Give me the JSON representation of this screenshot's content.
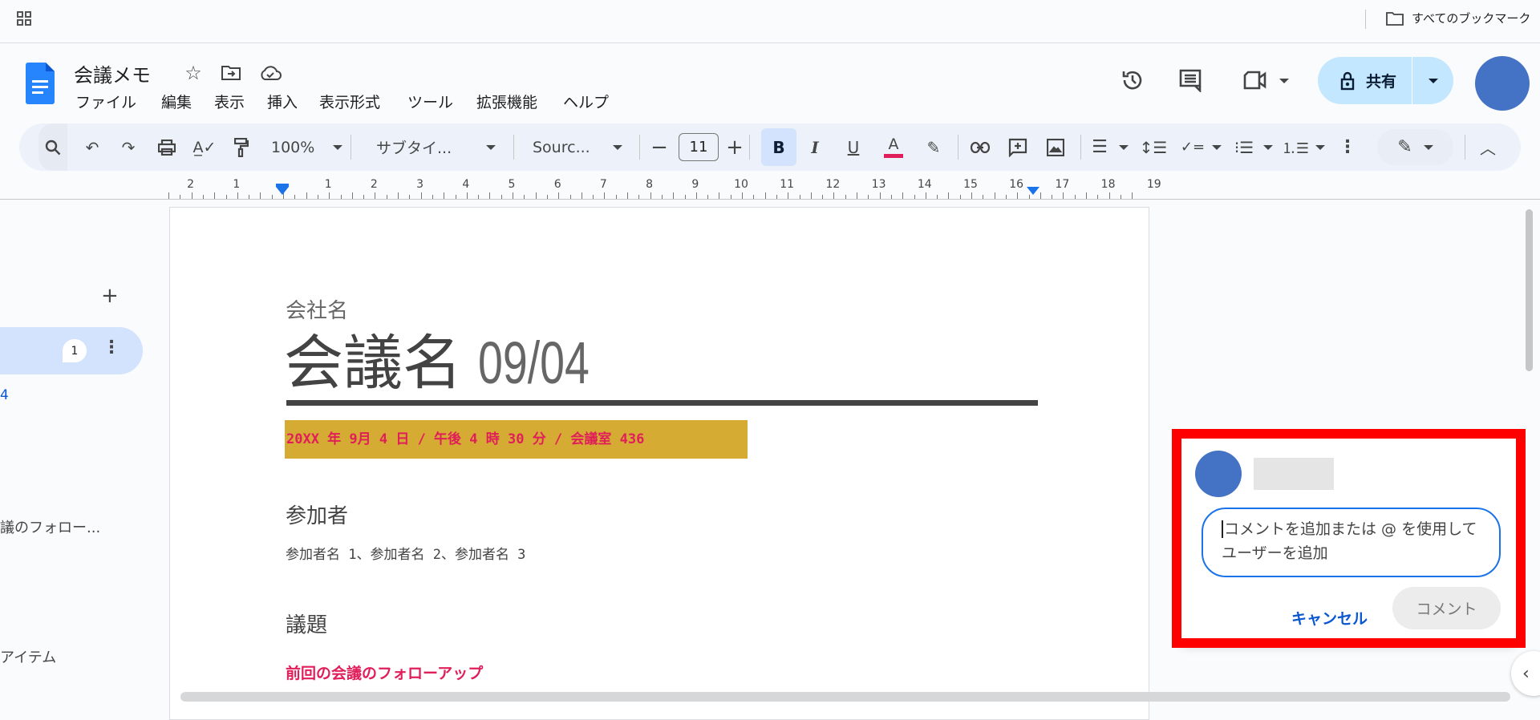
{
  "browser": {
    "bookmarks_label": "すべてのブックマーク"
  },
  "doc": {
    "title": "会議メモ"
  },
  "menu": [
    "ファイル",
    "編集",
    "表示",
    "挿入",
    "表示形式",
    "ツール",
    "拡張機能",
    "ヘルプ"
  ],
  "share": {
    "label": "共有"
  },
  "toolbar": {
    "zoom": "100%",
    "style": "サブタイ...",
    "font": "Sourc...",
    "font_size": "11"
  },
  "colors": {
    "accent": "#1a73e8",
    "text_color_bar": "#e01e5a",
    "highlight": "#d6ab33",
    "pink": "#e01e5a",
    "avatar": "#4472c4",
    "share_bg": "#c2e7ff",
    "frame": "#ff0000"
  },
  "ruler": {
    "labels": [
      "2",
      "1",
      "",
      "1",
      "2",
      "3",
      "4",
      "5",
      "6",
      "7",
      "8",
      "9",
      "10",
      "11",
      "12",
      "13",
      "14",
      "15",
      "16",
      "17",
      "18",
      "19"
    ]
  },
  "outline": {
    "badge": "1",
    "item_fragment": "4",
    "items": [
      "議のフォロー...",
      "アイテム"
    ]
  },
  "content": {
    "company": "会社名",
    "meeting_title": "会議名",
    "meeting_date": "09/04",
    "datetime_line": "20XX 年 9月 4 日 / 午後 4 時 30 分 / 会議室 436",
    "attendees_heading": "参加者",
    "attendees": "参加者名 1、参加者名 2、参加者名 3",
    "agenda_heading": "議題",
    "agenda_item": "前回の会議のフォローアップ"
  },
  "comment": {
    "placeholder": "コメントを追加または @ を使用してユーザーを追加",
    "cancel": "キャンセル",
    "submit": "コメント"
  }
}
